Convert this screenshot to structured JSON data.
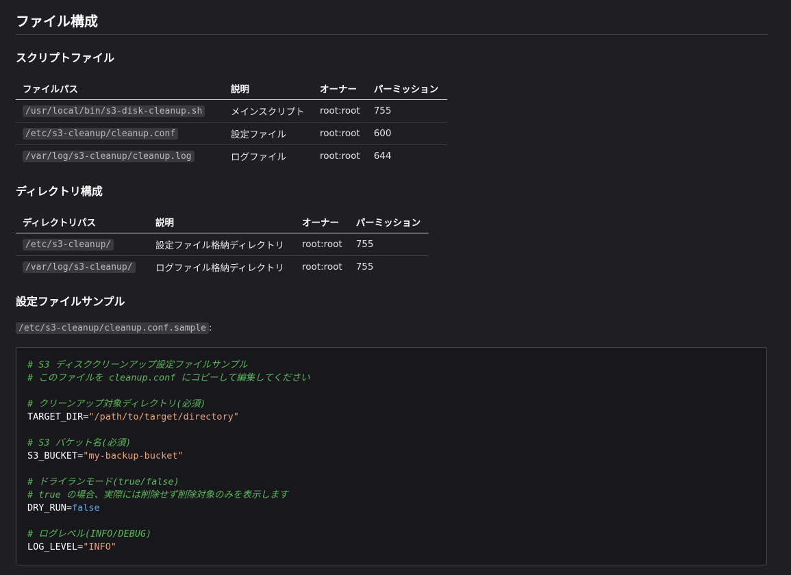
{
  "page_title": "ファイル構成",
  "scripts_section": {
    "heading": "スクリプトファイル",
    "headers": [
      "ファイルパス",
      "説明",
      "オーナー",
      "パーミッション"
    ],
    "rows": [
      {
        "path": "/usr/local/bin/s3-disk-cleanup.sh",
        "desc": "メインスクリプト",
        "owner": "root:root",
        "perm": "755"
      },
      {
        "path": "/etc/s3-cleanup/cleanup.conf",
        "desc": "設定ファイル",
        "owner": "root:root",
        "perm": "600"
      },
      {
        "path": "/var/log/s3-cleanup/cleanup.log",
        "desc": "ログファイル",
        "owner": "root:root",
        "perm": "644"
      }
    ]
  },
  "dirs_section": {
    "heading": "ディレクトリ構成",
    "headers": [
      "ディレクトリパス",
      "説明",
      "オーナー",
      "パーミッション"
    ],
    "rows": [
      {
        "path": "/etc/s3-cleanup/",
        "desc": "設定ファイル格納ディレクトリ",
        "owner": "root:root",
        "perm": "755"
      },
      {
        "path": "/var/log/s3-cleanup/",
        "desc": "ログファイル格納ディレクトリ",
        "owner": "root:root",
        "perm": "755"
      }
    ]
  },
  "sample_section": {
    "heading": "設定ファイルサンプル",
    "path": "/etc/s3-cleanup/cleanup.conf.sample",
    "path_suffix": ":",
    "code": {
      "c1": "# S3 ディスククリーンアップ設定ファイルサンプル",
      "c2": "# このファイルを cleanup.conf にコピーして編集してください",
      "c3": "# クリーンアップ対象ディレクトリ(必須)",
      "target_key": "TARGET_DIR=",
      "target_val": "\"/path/to/target/directory\"",
      "c4": "# S3 バケット名(必須)",
      "bucket_key": "S3_BUCKET=",
      "bucket_val": "\"my-backup-bucket\"",
      "c5": "# ドライランモード(true/false)",
      "c6": "# true の場合、実際には削除せず削除対象のみを表示します",
      "dry_key": "DRY_RUN=",
      "dry_val": "false",
      "c7": "# ログレベル(INFO/DEBUG)",
      "log_key": "LOG_LEVEL=",
      "log_val": "\"INFO\""
    }
  }
}
